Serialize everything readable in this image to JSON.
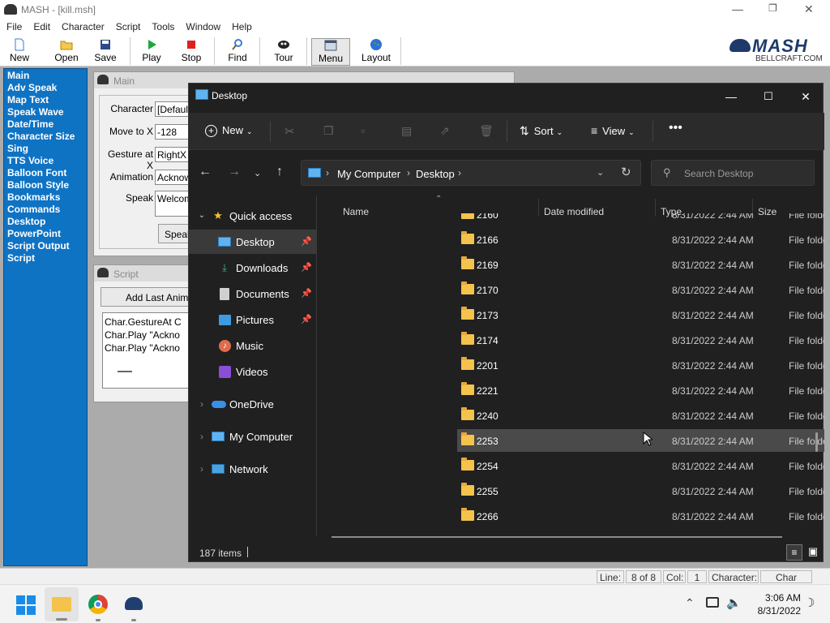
{
  "mash": {
    "title": "MASH - [kill.msh]",
    "menu": [
      "File",
      "Edit",
      "Character",
      "Script",
      "Tools",
      "Window",
      "Help"
    ],
    "toolbar": [
      {
        "label": "New",
        "icon": "new-document-icon"
      },
      {
        "label": "Open",
        "icon": "open-folder-icon"
      },
      {
        "label": "Save",
        "icon": "save-disk-icon"
      },
      {
        "label": "Play",
        "icon": "play-icon"
      },
      {
        "label": "Stop",
        "icon": "stop-icon"
      },
      {
        "label": "Find",
        "icon": "find-magnifier-icon"
      },
      {
        "label": "Tour",
        "icon": "tour-character-icon"
      },
      {
        "label": "Menu",
        "icon": "menu-window-icon"
      },
      {
        "label": "Layout",
        "icon": "layout-globe-icon"
      }
    ],
    "logo": {
      "brand": "MASH",
      "sub": "BELLCRAFT.COM"
    },
    "sidebar": [
      "Main",
      "Adv Speak",
      "Map Text",
      "Speak Wave",
      "Date/Time",
      "Character Size",
      "Sing",
      "TTS Voice",
      "Balloon Font",
      "Balloon Style",
      "Bookmarks",
      "Commands",
      "Desktop",
      "PowerPoint",
      "Script Output",
      "Script"
    ],
    "main_window": {
      "title": "Main",
      "fields": [
        {
          "label": "Character",
          "value": "[Default"
        },
        {
          "label": "Move to X",
          "value": "-128"
        },
        {
          "label": "Gesture at X",
          "value": "RightX"
        },
        {
          "label": "Animation",
          "value": "Acknow"
        },
        {
          "label": "Speak",
          "value": "Welcom"
        }
      ],
      "speak_button": "Speak"
    },
    "script_window": {
      "title": "Script",
      "add_button": "Add Last Animat",
      "lines": [
        "Char.GestureAt C",
        "Char.Play \"Ackno",
        "Char.Play \"Ackno"
      ]
    },
    "status": {
      "line_label": "Line:",
      "line_value": "8 of 8",
      "col_label": "Col:",
      "col_value": "1",
      "char_label": "Character:",
      "char_value": "Char"
    }
  },
  "explorer": {
    "title": "Desktop",
    "commands": {
      "new": "New",
      "sort": "Sort",
      "view": "View"
    },
    "breadcrumb": [
      "My Computer",
      "Desktop"
    ],
    "search_placeholder": "Search Desktop",
    "columns": {
      "name": "Name",
      "date": "Date modified",
      "type": "Type",
      "size": "Size"
    },
    "nav": {
      "quick_access": "Quick access",
      "pinned": [
        "Desktop",
        "Downloads",
        "Documents",
        "Pictures",
        "Music",
        "Videos"
      ],
      "onedrive": "OneDrive",
      "my_computer": "My Computer",
      "network": "Network"
    },
    "rows": [
      {
        "name": "2160",
        "date": "8/31/2022 2:44 AM",
        "type": "File folder"
      },
      {
        "name": "2166",
        "date": "8/31/2022 2:44 AM",
        "type": "File folder"
      },
      {
        "name": "2169",
        "date": "8/31/2022 2:44 AM",
        "type": "File folder"
      },
      {
        "name": "2170",
        "date": "8/31/2022 2:44 AM",
        "type": "File folder"
      },
      {
        "name": "2173",
        "date": "8/31/2022 2:44 AM",
        "type": "File folder"
      },
      {
        "name": "2174",
        "date": "8/31/2022 2:44 AM",
        "type": "File folder"
      },
      {
        "name": "2201",
        "date": "8/31/2022 2:44 AM",
        "type": "File folder"
      },
      {
        "name": "2221",
        "date": "8/31/2022 2:44 AM",
        "type": "File folder"
      },
      {
        "name": "2240",
        "date": "8/31/2022 2:44 AM",
        "type": "File folder"
      },
      {
        "name": "2253",
        "date": "8/31/2022 2:44 AM",
        "type": "File folder"
      },
      {
        "name": "2254",
        "date": "8/31/2022 2:44 AM",
        "type": "File folder"
      },
      {
        "name": "2255",
        "date": "8/31/2022 2:44 AM",
        "type": "File folder"
      },
      {
        "name": "2266",
        "date": "8/31/2022 2:44 AM",
        "type": "File folder"
      }
    ],
    "item_count": "187 items"
  },
  "taskbar": {
    "time": "3:06 AM",
    "date": "8/31/2022"
  }
}
